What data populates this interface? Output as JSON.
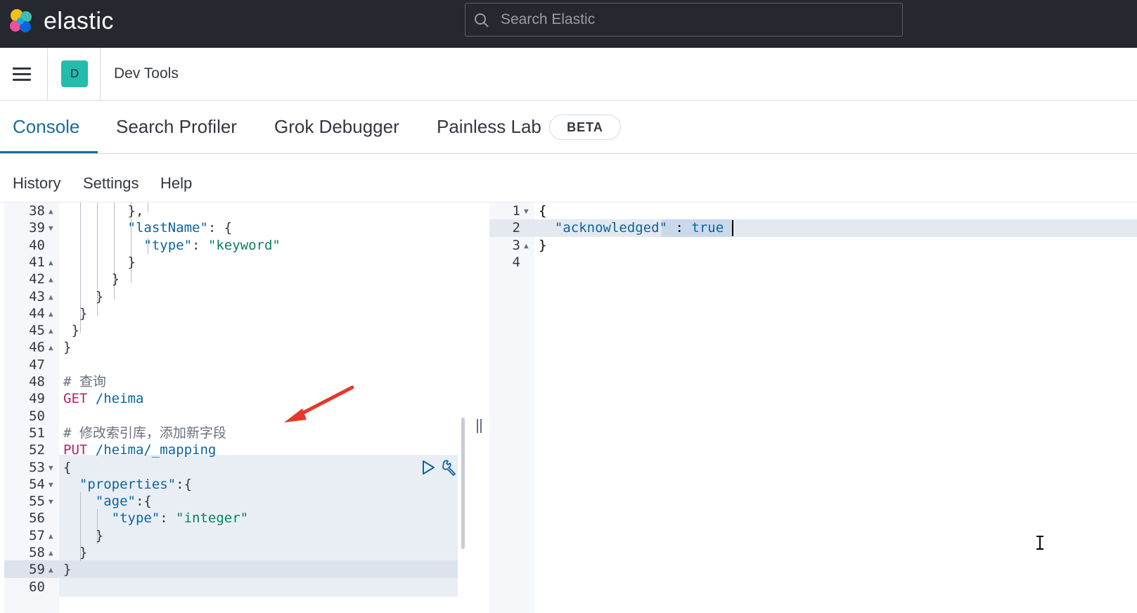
{
  "topbar": {
    "brand": "elastic",
    "search_placeholder": "Search Elastic"
  },
  "header": {
    "space_initial": "D",
    "page_title": "Dev Tools"
  },
  "tabs": [
    {
      "label": "Console",
      "active": true
    },
    {
      "label": "Search Profiler",
      "active": false
    },
    {
      "label": "Grok Debugger",
      "active": false
    },
    {
      "label": "Painless Lab",
      "active": false
    }
  ],
  "beta_badge": "BETA",
  "subnav": {
    "history": "History",
    "settings": "Settings",
    "help": "Help"
  },
  "request_editor": {
    "lines": [
      {
        "n": "38",
        "fold": "▲",
        "code": "        },"
      },
      {
        "n": "39",
        "fold": "▼",
        "code": "        \"lastName\": {"
      },
      {
        "n": "40",
        "fold": "",
        "code": "          \"type\": \"keyword\""
      },
      {
        "n": "41",
        "fold": "▲",
        "code": "        }"
      },
      {
        "n": "42",
        "fold": "▲",
        "code": "      }"
      },
      {
        "n": "43",
        "fold": "▲",
        "code": "    }"
      },
      {
        "n": "44",
        "fold": "▲",
        "code": "  }"
      },
      {
        "n": "45",
        "fold": "▲",
        "code": " }"
      },
      {
        "n": "46",
        "fold": "▲",
        "code": "}"
      },
      {
        "n": "47",
        "fold": "",
        "code": ""
      },
      {
        "n": "48",
        "fold": "",
        "code": "# 查询"
      },
      {
        "n": "49",
        "fold": "",
        "code": "GET /heima"
      },
      {
        "n": "50",
        "fold": "",
        "code": ""
      },
      {
        "n": "51",
        "fold": "",
        "code": "# 修改索引库，添加新字段"
      },
      {
        "n": "52",
        "fold": "",
        "code": "PUT /heima/_mapping"
      },
      {
        "n": "53",
        "fold": "▼",
        "code": "{"
      },
      {
        "n": "54",
        "fold": "▼",
        "code": "  \"properties\":{"
      },
      {
        "n": "55",
        "fold": "▼",
        "code": "    \"age\":{"
      },
      {
        "n": "56",
        "fold": "",
        "code": "      \"type\": \"integer\""
      },
      {
        "n": "57",
        "fold": "▲",
        "code": "    }"
      },
      {
        "n": "58",
        "fold": "▲",
        "code": "  }"
      },
      {
        "n": "59",
        "fold": "▲",
        "code": "}"
      },
      {
        "n": "60",
        "fold": "",
        "code": ""
      }
    ]
  },
  "response_editor": {
    "lines": [
      {
        "n": "1",
        "fold": "▼",
        "code": "{"
      },
      {
        "n": "2",
        "fold": "",
        "code": "  \"acknowledged\" : true"
      },
      {
        "n": "3",
        "fold": "▲",
        "code": "}"
      },
      {
        "n": "4",
        "fold": "",
        "code": ""
      }
    ]
  },
  "colors": {
    "topbar": "#25282f",
    "accent": "#1a6b97",
    "space_avatar": "#22bdac",
    "method": "#b0246b",
    "string": "#0a7d62",
    "key": "#0b64a0",
    "arrow": "#e7362b"
  },
  "icons": [
    "elastic-logo-icon",
    "search-icon",
    "menu-icon",
    "run-request-icon",
    "wrench-icon",
    "text-cursor-icon",
    "red-arrow-annotation"
  ]
}
